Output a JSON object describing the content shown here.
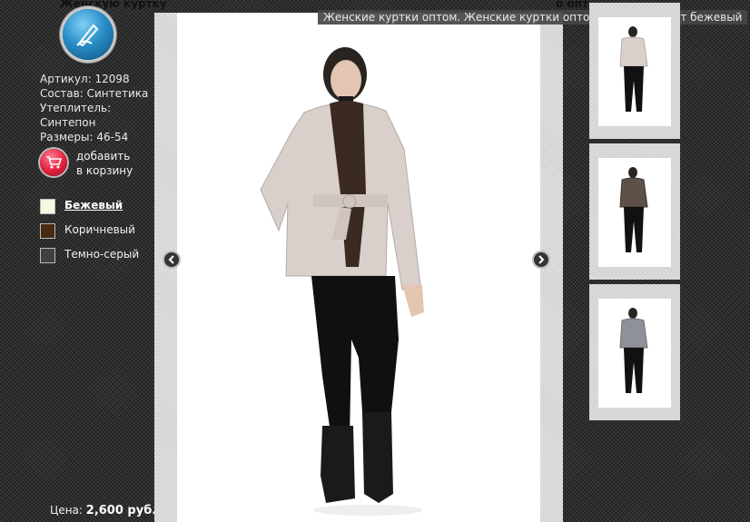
{
  "page": {
    "title": "Женскую куртку",
    "title_right": "о опт"
  },
  "product": {
    "article": "Артикул: 12098",
    "composition": "Состав: Синтетика",
    "insulation_label": "Утеплитель:",
    "insulation_value": "Синтепон",
    "sizes": "Размеры: 46-54"
  },
  "cart": {
    "label_line1": "добавить",
    "label_line2": "в корзину",
    "icon": "shopping-cart-icon"
  },
  "colors": [
    {
      "label": "Бежевый",
      "swatch": "#f7f7e0",
      "selected": true
    },
    {
      "label": "Коричневый",
      "swatch": "#4a2a10",
      "selected": false
    },
    {
      "label": "Темно-серый",
      "swatch": "#404040",
      "selected": false
    }
  ],
  "price": {
    "label": "Цена:",
    "value": "2,600 руб."
  },
  "viewer": {
    "caption": "Женские куртки оптом. Женские куртки оптом в Москве. цвет бежевый",
    "prev_icon": "chevron-left-icon",
    "next_icon": "chevron-right-icon"
  },
  "thumbnails": [
    {
      "name": "beige",
      "jacket_color": "#d9cfcb"
    },
    {
      "name": "brown",
      "jacket_color": "#5c5049"
    },
    {
      "name": "gray",
      "jacket_color": "#8e9298"
    }
  ]
}
